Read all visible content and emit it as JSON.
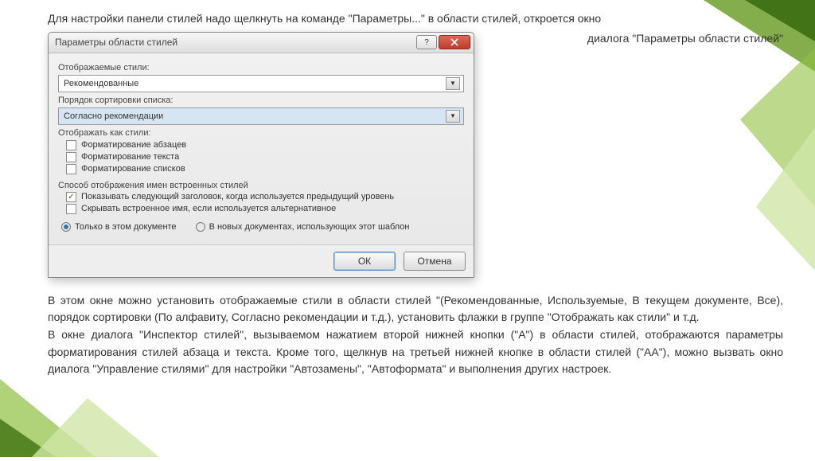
{
  "intro": "Для настройки панели стилей надо щелкнуть на команде \"Параметры...\" в области стилей, откроется окно",
  "subtitle": "диалога \"Параметры области стилей\"",
  "dialog": {
    "title": "Параметры области стилей",
    "label_displayed": "Отображаемые стили:",
    "combo1": "Рекомендованные",
    "label_sort": "Порядок сортировки списка:",
    "combo2": "Согласно рекомендации",
    "label_show_as": "Отображать как стили:",
    "chk1": "Форматирование абзацев",
    "chk2": "Форматирование текста",
    "chk3": "Форматирование списков",
    "label_builtin": "Способ отображения имен встроенных стилей",
    "chk4": "Показывать следующий заголовок, когда используется предыдущий уровень",
    "chk5": "Скрывать встроенное имя, если используется альтернативное",
    "radio1": "Только в этом документе",
    "radio2": "В новых документах, использующих этот шаблон",
    "btn_ok": "ОК",
    "btn_cancel": "Отмена"
  },
  "para1": "В этом окне можно установить отображаемые стили в области стилей \"(Рекомендованные, Используемые, В текущем документе, Все), порядок сортировки (По алфавиту, Согласно рекомендации и т.д.), установить флажки в группе \"Отображать как стили\" и т.д.",
  "para2": "В окне диалога \"Инспектор стилей\", вызываемом нажатием второй нижней кнопки (\"А\") в области стилей, отображаются параметры форматирования стилей абзаца и текста. Кроме того, щелкнув на третьей нижней кнопке в области стилей (\"АА\"), можно вызвать окно диалога \"Управление стилями\" для настройки \"Автозамены\", \"Автоформата\" и выполнения других настроек."
}
